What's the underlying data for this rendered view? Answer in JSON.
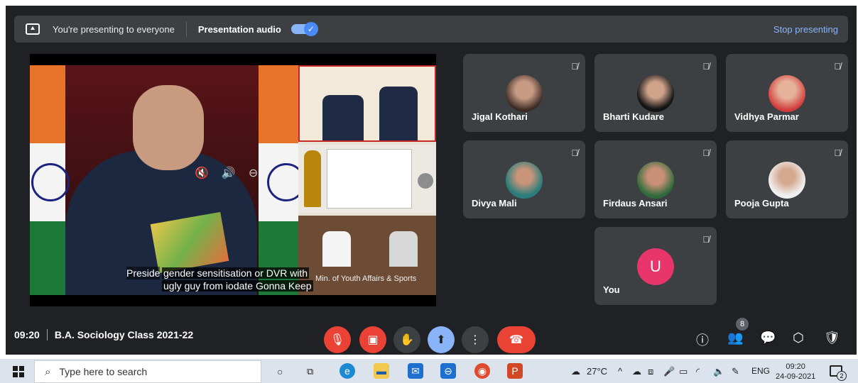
{
  "banner": {
    "presenting_text": "You're presenting to everyone",
    "audio_label": "Presentation audio",
    "audio_enabled": true,
    "stop_label": "Stop presenting"
  },
  "presentation": {
    "caption_prefix": "Preside",
    "caption_line1": "gender sensitisation or DVR with",
    "caption_line2": "ugly guy from iodate Gonna Keep",
    "slide_footer": "Min. of Youth Affairs & Sports"
  },
  "participants": [
    {
      "name": "Jigal Kothari",
      "muted": true,
      "avatar": "photo"
    },
    {
      "name": "Bharti Kudare",
      "muted": true,
      "avatar": "photo"
    },
    {
      "name": "Vidhya Parmar",
      "muted": true,
      "avatar": "photo"
    },
    {
      "name": "Divya Mali",
      "muted": true,
      "avatar": "photo"
    },
    {
      "name": "Firdaus Ansari",
      "muted": true,
      "avatar": "photo"
    },
    {
      "name": "Pooja Gupta",
      "muted": true,
      "avatar": "photo"
    },
    {
      "name": "You",
      "muted": true,
      "avatar": "U",
      "avatar_color": "#e8356b"
    }
  ],
  "meeting": {
    "time": "09:20",
    "title": "B.A. Sociology Class 2021-22",
    "people_count": "8"
  },
  "controls": {
    "icons": [
      "mic-off-icon",
      "camera-off-icon",
      "raise-hand-icon",
      "present-icon",
      "more-options-icon",
      "hang-up-icon"
    ],
    "right_icons": [
      "info-icon",
      "people-icon",
      "chat-icon",
      "activities-icon",
      "host-controls-icon"
    ]
  },
  "taskbar": {
    "search_placeholder": "Type here to search",
    "temperature": "27°C",
    "language": "ENG",
    "clock_time": "09:20",
    "clock_date": "24-09-2021",
    "notifications": "2"
  }
}
